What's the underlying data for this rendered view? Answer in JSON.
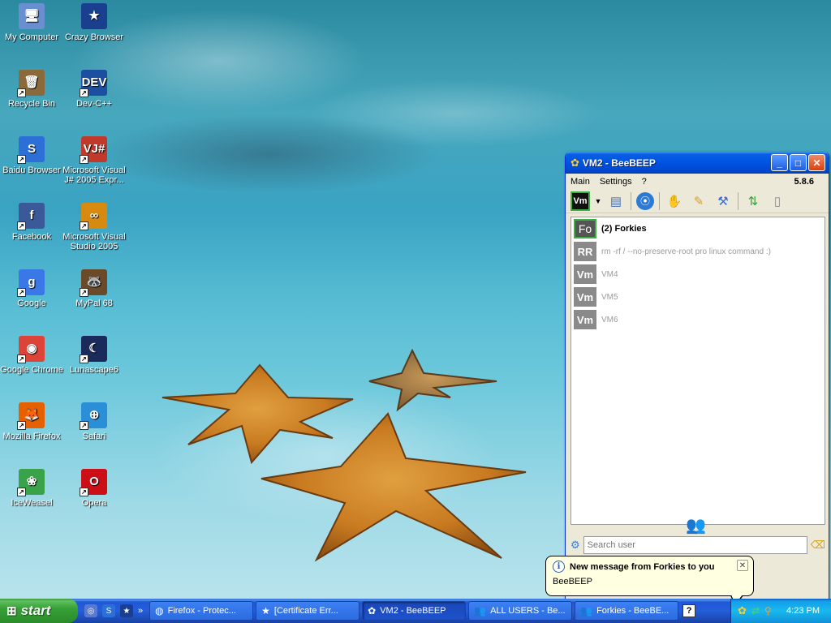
{
  "desktop": {
    "icons": [
      {
        "label": "My Computer",
        "glyph": "🖥",
        "color": "#6a8fd0"
      },
      {
        "label": "Crazy Browser",
        "glyph": "★",
        "color": "#1a3f8f"
      },
      {
        "label": "Recycle Bin",
        "glyph": "🗑",
        "color": "#8a6a3a"
      },
      {
        "label": "Dev-C++",
        "glyph": "DEV",
        "color": "#1d4fa0"
      },
      {
        "label": "Baidu Browser",
        "glyph": "S",
        "color": "#2c6fd6"
      },
      {
        "label": "Microsoft Visual J# 2005 Expr...",
        "glyph": "VJ#",
        "color": "#c0392b"
      },
      {
        "label": "Facebook",
        "glyph": "f",
        "color": "#3b5998"
      },
      {
        "label": "Microsoft Visual Studio 2005",
        "glyph": "∞",
        "color": "#d68a10"
      },
      {
        "label": "Google",
        "glyph": "g",
        "color": "#3b78e7"
      },
      {
        "label": "MyPal 68",
        "glyph": "🦝",
        "color": "#6b4a2a"
      },
      {
        "label": "Google Chrome",
        "glyph": "◉",
        "color": "#db4437"
      },
      {
        "label": "Lunascape6",
        "glyph": "☾",
        "color": "#1a2a5a"
      },
      {
        "label": "Mozilla Firefox",
        "glyph": "🦊",
        "color": "#e66000"
      },
      {
        "label": "Safari",
        "glyph": "⊕",
        "color": "#2a8fd6"
      },
      {
        "label": "IceWeasel",
        "glyph": "❀",
        "color": "#3aa34a"
      },
      {
        "label": "Opera",
        "glyph": "O",
        "color": "#cc0f16"
      }
    ]
  },
  "window": {
    "title": "VM2 - BeeBEEP",
    "title_icon": "bee-icon",
    "menu": {
      "main": "Main",
      "settings": "Settings",
      "help": "?"
    },
    "version": "5.8.6",
    "toolbar_vm": "Vm",
    "list": [
      {
        "badge": "Fo",
        "name": "(2) Forkies",
        "active": true
      },
      {
        "badge": "RR",
        "name": "rm -rf / --no-preserve-root pro linux command :)",
        "active": false
      },
      {
        "badge": "Vm",
        "name": "VM4",
        "active": false
      },
      {
        "badge": "Vm",
        "name": "VM5",
        "active": false
      },
      {
        "badge": "Vm",
        "name": "VM6",
        "active": false
      }
    ],
    "search_placeholder": "Search user"
  },
  "balloon": {
    "title": "New message from Forkies to you",
    "body": "BeeBEEP"
  },
  "taskbar": {
    "start": "start",
    "quick_more": "»",
    "tasks": [
      {
        "label": "Firefox - Protec...",
        "icon": "firefox-icon",
        "active": false
      },
      {
        "label": "[Certificate Err...",
        "icon": "crazy-browser-icon",
        "active": false
      },
      {
        "label": "VM2 - BeeBEEP",
        "icon": "bee-icon",
        "active": true
      },
      {
        "label": "ALL USERS - Be...",
        "icon": "users-icon",
        "active": false
      },
      {
        "label": "Forkies - BeeBE...",
        "icon": "users-icon",
        "active": false
      }
    ],
    "help_glyph": "?",
    "clock": "4:23 PM"
  }
}
